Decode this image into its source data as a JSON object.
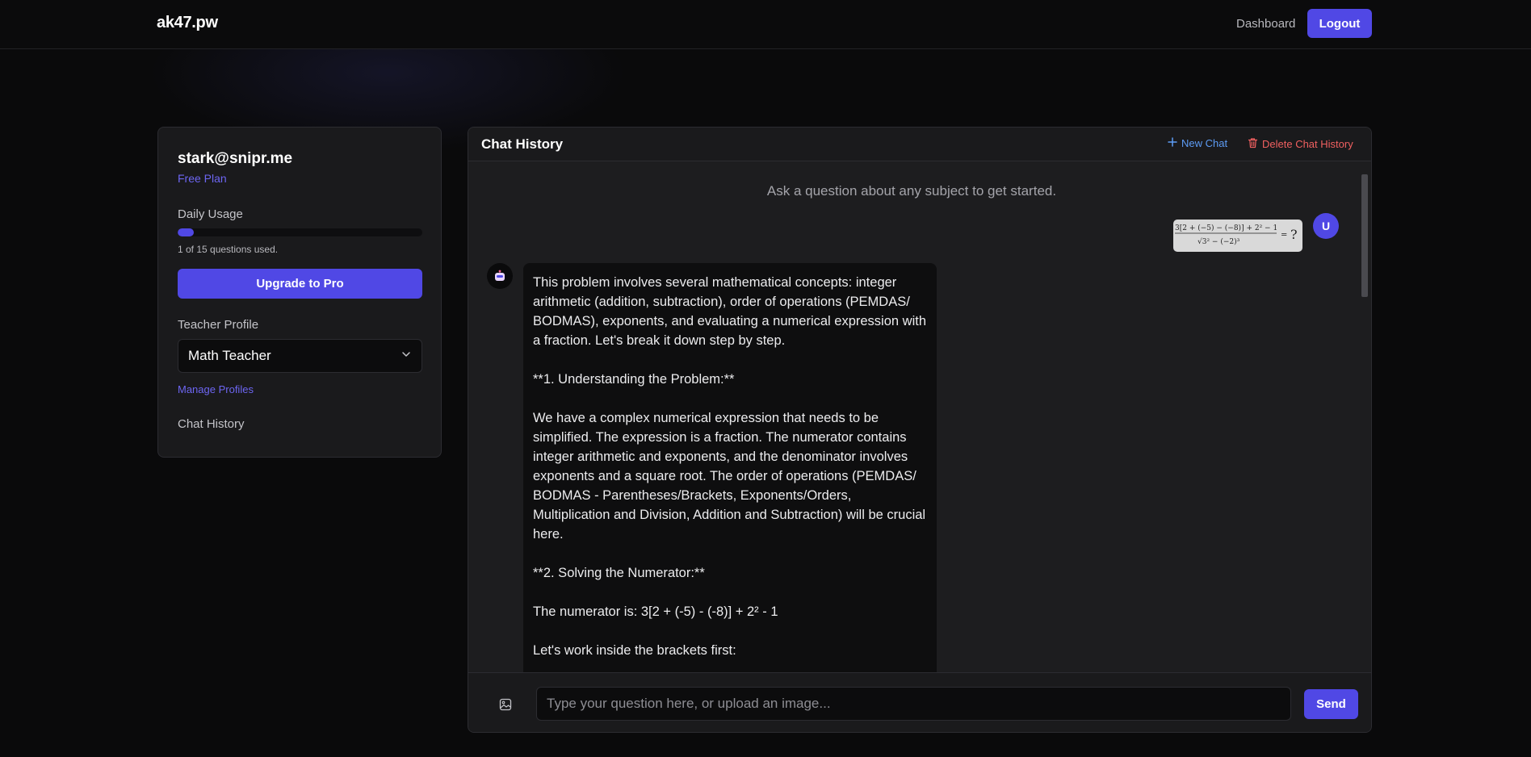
{
  "nav": {
    "brand": "ak47.pw",
    "dashboard_label": "Dashboard",
    "logout_label": "Logout"
  },
  "sidebar": {
    "email": "stark@snipr.me",
    "plan": "Free Plan",
    "usage_label": "Daily Usage",
    "usage_fraction": 0.0667,
    "usage_text": "1 of 15 questions used.",
    "upgrade_label": "Upgrade to Pro",
    "teacher_profile_label": "Teacher Profile",
    "teacher_profile_value": "Math Teacher",
    "manage_profiles_label": "Manage Profiles",
    "chat_history_label": "Chat History"
  },
  "chat": {
    "title": "Chat History",
    "new_chat_label": "New Chat",
    "delete_history_label": "Delete Chat History",
    "hint": "Ask a question about any subject to get started.",
    "user_avatar": "U",
    "user_image_formula": "3[2 + (−5) − (−8)] + 2² − 1 / √(3² − (−2)³) = ?",
    "bot_paragraphs": [
      "This problem involves several mathematical concepts: integer arithmetic (addition, subtraction), order of operations (PEMDAS/ BODMAS), exponents, and evaluating a numerical expression with a fraction. Let's break it down step by step.",
      "**1. Understanding the Problem:**",
      "We have a complex numerical expression that needs to be simplified. The expression is a fraction. The numerator contains integer arithmetic and exponents, and the denominator involves exponents and a square root. The order of operations (PEMDAS/ BODMAS - Parentheses/Brackets, Exponents/Orders, Multiplication and Division, Addition and Subtraction) will be crucial here.",
      "**2. Solving the Numerator:**",
      "The numerator is: 3[2 + (-5) - (-8)] + 2² - 1",
      "Let's work inside the brackets first:"
    ],
    "input_placeholder": "Type your question here, or upload an image...",
    "send_label": "Send"
  },
  "colors": {
    "accent": "#5048e5",
    "link_blue": "#5d9cf5",
    "danger": "#f06060",
    "plan_purple": "#6d66f2"
  }
}
